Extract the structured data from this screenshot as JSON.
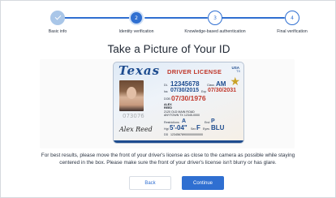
{
  "stepper": {
    "steps": [
      {
        "label": "Basic info",
        "number": "1",
        "state": "done"
      },
      {
        "label": "Identity verification",
        "number": "2",
        "state": "active"
      },
      {
        "label": "Knowledge-based authentication",
        "number": "3",
        "state": "todo"
      },
      {
        "label": "Final verification",
        "number": "4",
        "state": "todo"
      }
    ]
  },
  "page": {
    "title": "Take a Picture of Your ID",
    "instruction": "For best results, please move the front of your driver's license as close to the camera as possible while staying centered in the box. Please make sure the front of your driver's license isn't blurry or has glare."
  },
  "id_card": {
    "state": "Texas",
    "doc_title": "DRIVER LICENSE",
    "country": "USA",
    "region": "TX",
    "dl_label": "DL",
    "dl_number": "12345678",
    "class_label": "Class",
    "class_value": "AM",
    "iss_label": "Iss",
    "iss_value": "07/30/2015",
    "exp_label": "Exp",
    "exp_value": "07/30/2031",
    "dob_label": "DOB",
    "dob_value": "07/30/1976",
    "name_line1": "ALEX",
    "name_line2": "REED",
    "address_line1": "2120 OLD MAIN ROAD",
    "address_line2": "ANYTOWN TX 12345-0000",
    "restrictions_label": "Restrictions",
    "restrictions_value": "A",
    "end_label": "End",
    "end_value": "P",
    "hgt_label": "Hgt",
    "hgt_value": "5'-04\"",
    "sex_label": "Sex",
    "sex_value": "F",
    "eyes_label": "Eyes",
    "eyes_value": "BLU",
    "dd_label": "DD",
    "dd_value": "12345678900000000000",
    "ghost_number": "073076",
    "signature": "Alex Reed"
  },
  "buttons": {
    "back": "Back",
    "continue": "Continue"
  },
  "colors": {
    "accent": "#2f6fd1",
    "completed_step": "#a9c6e8",
    "id_blue": "#1e4c8f",
    "id_red": "#c0382b"
  },
  "icons": {
    "completed_step": "check-icon",
    "id_seal": "star-icon"
  }
}
